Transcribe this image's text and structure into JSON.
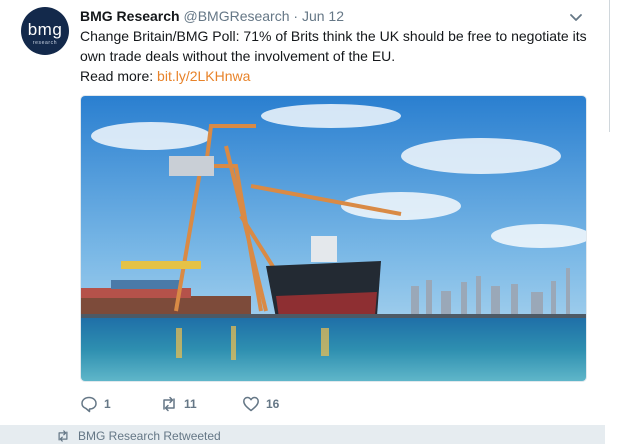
{
  "tweet": {
    "avatar_text": "bmg",
    "avatar_subtext": "research",
    "author_name": "BMG Research",
    "handle": "@BMGResearch",
    "separator": "·",
    "time": "Jun 12",
    "text_line1": "Change Britain/BMG Poll: 71% of Brits think the UK should be free to negotiate its own trade deals without the involvement of the EU.",
    "read_more_label": "Read more:",
    "link_text": "bit.ly/2LKHnwa",
    "link_color": "#e8832a",
    "media_icon": "container-port-photo",
    "reply_count": "1",
    "retweet_count": "11",
    "like_count": "16"
  },
  "next": {
    "retweet_notice": "BMG Research Retweeted"
  }
}
